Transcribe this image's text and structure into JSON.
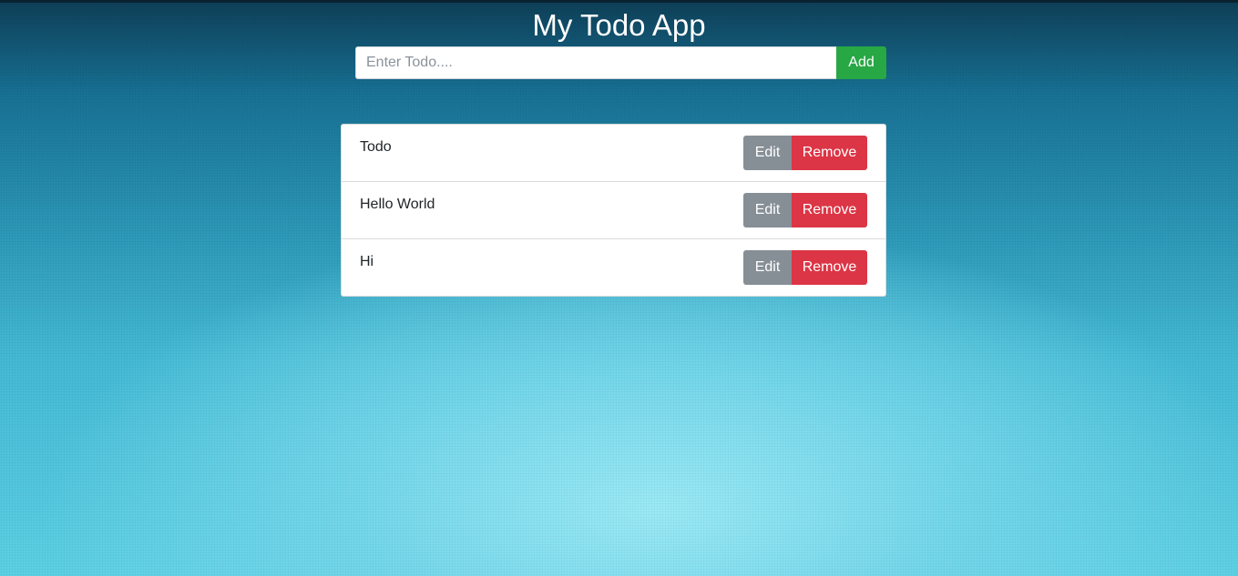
{
  "app": {
    "title": "My Todo App"
  },
  "form": {
    "input_value": "",
    "input_placeholder": "Enter Todo....",
    "add_label": "Add"
  },
  "todos": [
    {
      "text": "Todo",
      "edit_label": "Edit",
      "remove_label": "Remove"
    },
    {
      "text": "Hello World",
      "edit_label": "Edit",
      "remove_label": "Remove"
    },
    {
      "text": "Hi",
      "edit_label": "Edit",
      "remove_label": "Remove"
    }
  ],
  "colors": {
    "add_button": "#28a745",
    "edit_button": "#868e96",
    "remove_button": "#dc3545"
  }
}
